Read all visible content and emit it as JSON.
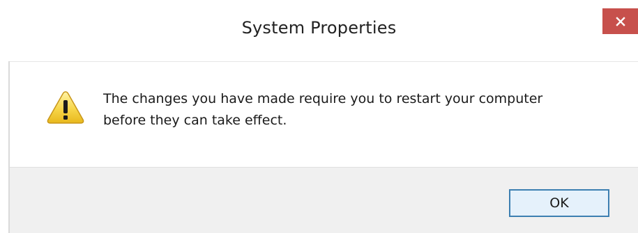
{
  "dialog": {
    "title": "System Properties",
    "close_icon": "close-x-icon",
    "close_color": "#c7504c",
    "warning_icon": "warning-triangle-icon",
    "message_line_1": "The changes you have made require you to restart your computer",
    "message_line_2": "before they can take effect.",
    "ok_label": "OK",
    "ok_border_color": "#3c7fb1",
    "footer_color": "#f0f0f0"
  }
}
